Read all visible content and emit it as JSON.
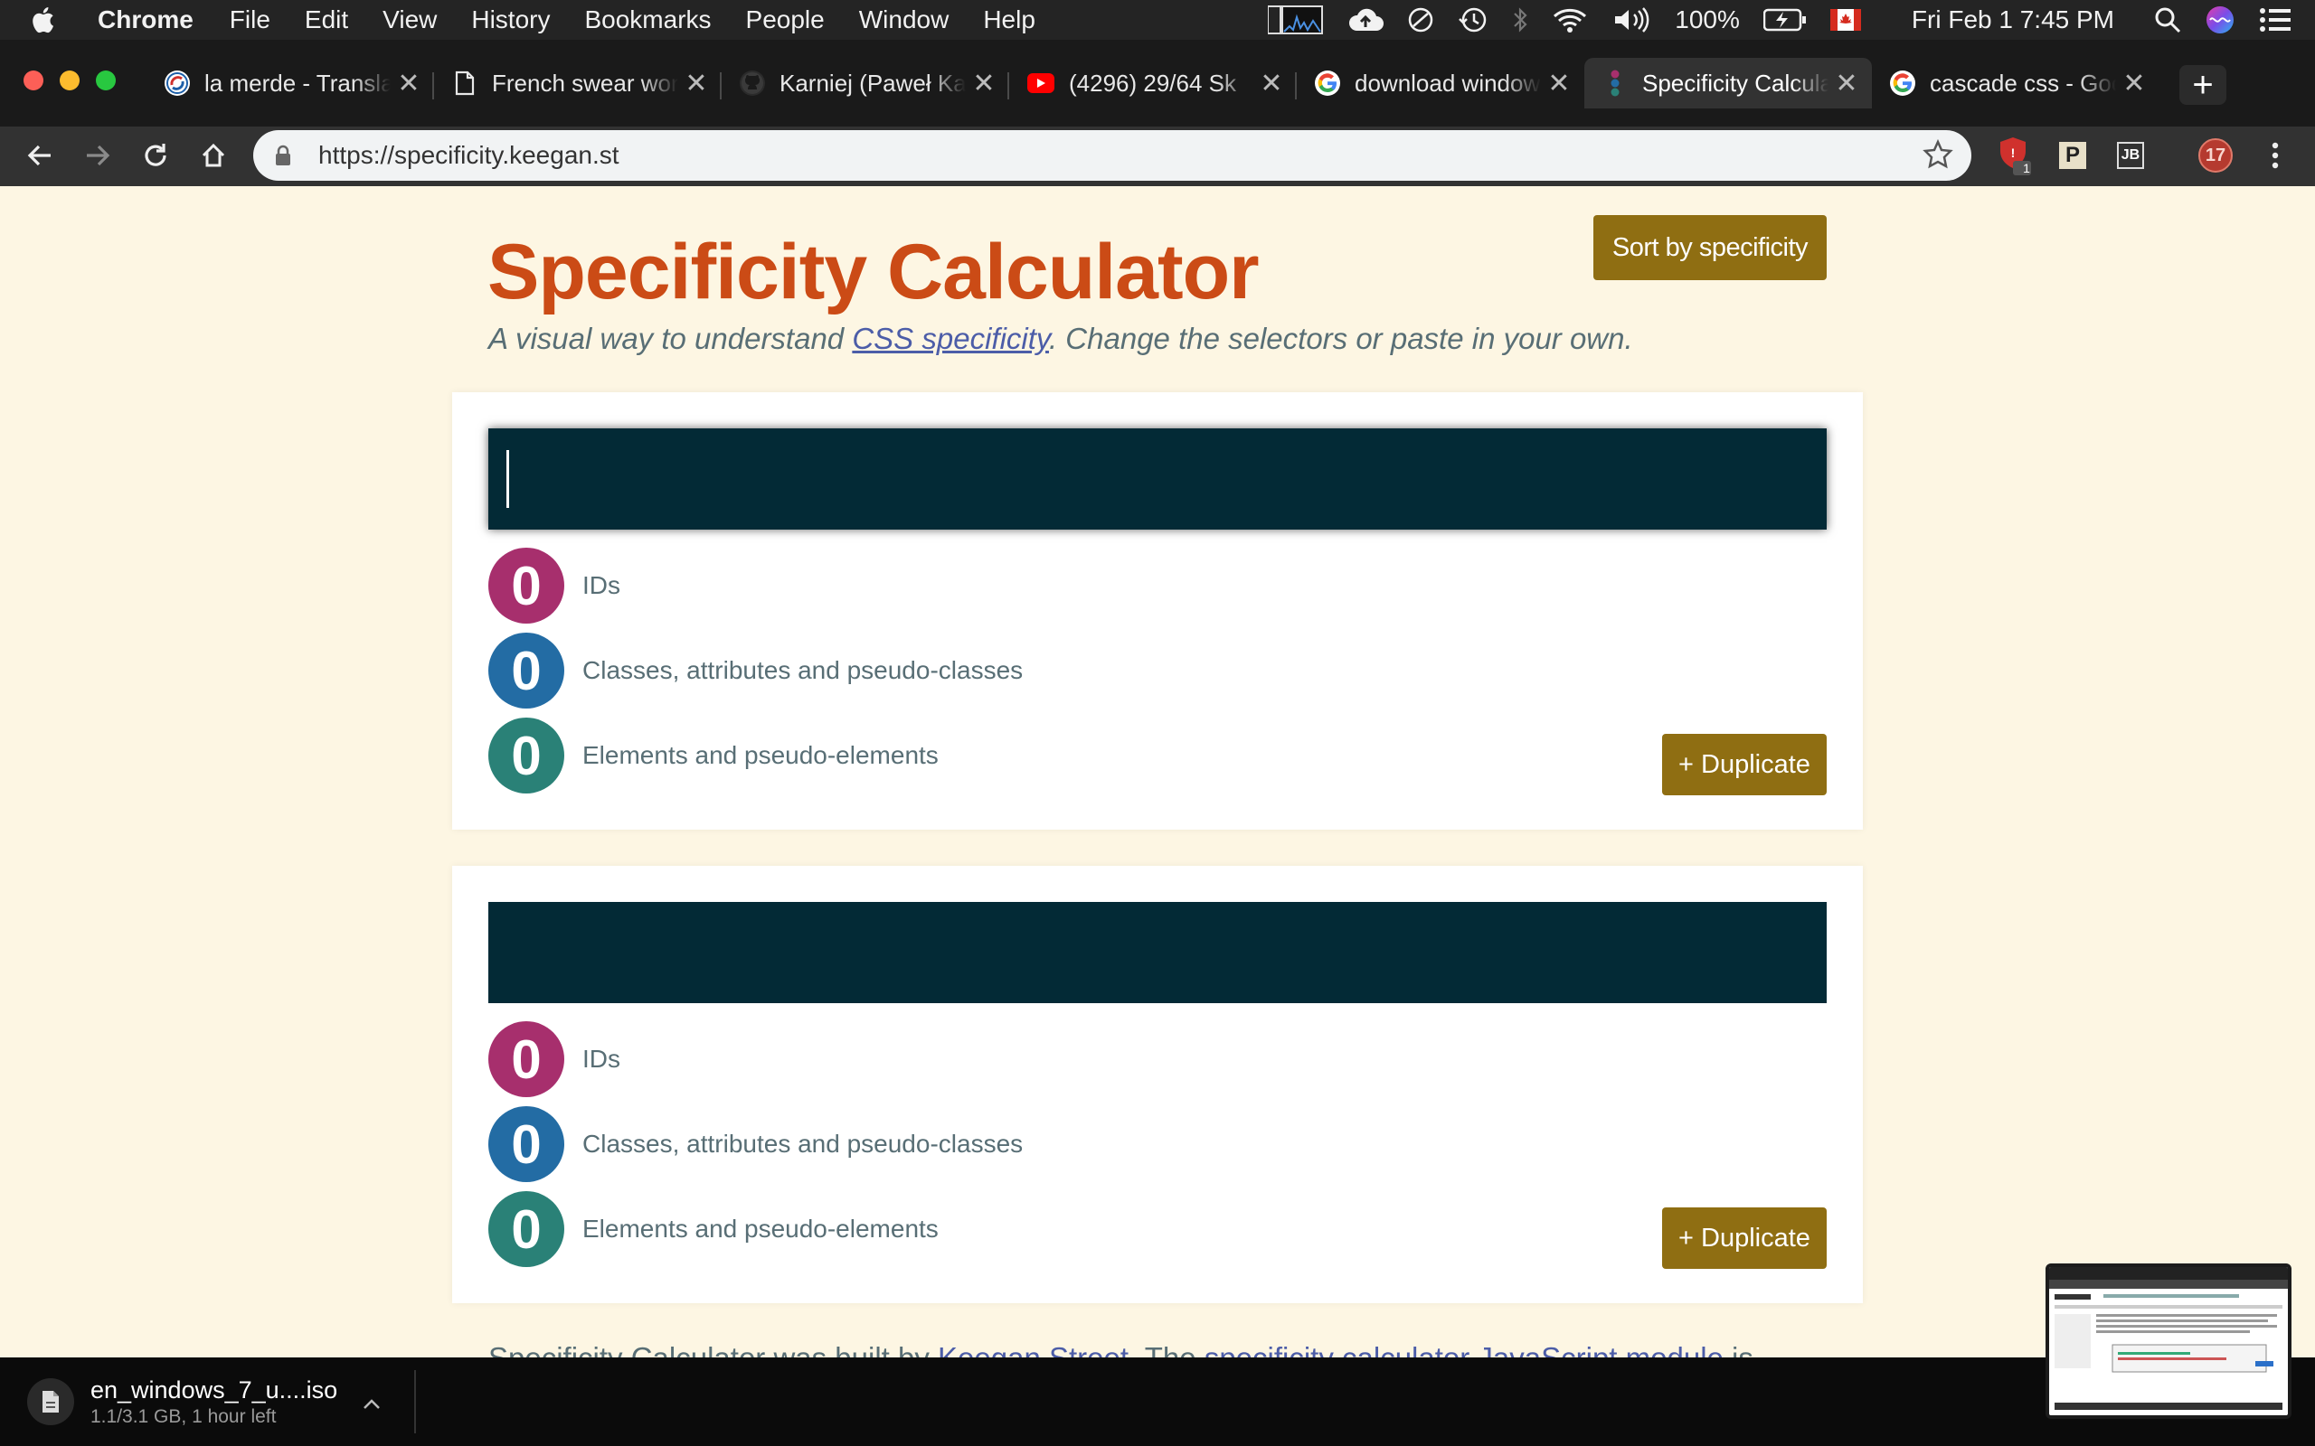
{
  "menubar": {
    "app_name": "Chrome",
    "items": [
      "File",
      "Edit",
      "View",
      "History",
      "Bookmarks",
      "People",
      "Window",
      "Help"
    ],
    "battery": "100%",
    "clock": "Fri Feb 1  7:45 PM"
  },
  "tabs": [
    {
      "title": "la merde - Translate",
      "icon": "reverso-icon",
      "active": false
    },
    {
      "title": "French swear words",
      "icon": "document-icon",
      "active": false
    },
    {
      "title": "Karniej (Paweł Karniej)",
      "icon": "github-icon",
      "active": false
    },
    {
      "title": "(4296) 29/64 Sk",
      "icon": "youtube-icon",
      "active": false
    },
    {
      "title": "download windows",
      "icon": "google-icon",
      "active": false
    },
    {
      "title": "Specificity Calculator",
      "icon": "specificity-icon",
      "active": true
    },
    {
      "title": "cascade css - Google",
      "icon": "google-icon",
      "active": false
    }
  ],
  "address_bar": {
    "url": "https://specificity.keegan.st"
  },
  "extensions": {
    "badge_count": "1",
    "pinterest_label": "P",
    "jb_label": "JB",
    "profile_count": "17"
  },
  "page": {
    "title": "Specificity Calculator",
    "subtitle_before": "A visual way to understand ",
    "subtitle_link": "CSS specificity",
    "subtitle_after": ". Change the selectors or paste in your own.",
    "sort_button": "Sort by specificity",
    "cards": [
      {
        "selector_value": "",
        "ids": {
          "count": "0",
          "label": "IDs"
        },
        "classes": {
          "count": "0",
          "label": "Classes, attributes and pseudo-classes"
        },
        "elements": {
          "count": "0",
          "label": "Elements and pseudo-elements"
        },
        "duplicate_button": "+ Duplicate"
      },
      {
        "selector_value": "",
        "ids": {
          "count": "0",
          "label": "IDs"
        },
        "classes": {
          "count": "0",
          "label": "Classes, attributes and pseudo-classes"
        },
        "elements": {
          "count": "0",
          "label": "Elements and pseudo-elements"
        },
        "duplicate_button": "+ Duplicate"
      }
    ],
    "footer_before": "Specificity Calculator was built by ",
    "footer_link1": "Keegan Street",
    "footer_middle": ". The ",
    "footer_link2": "specificity calculator JavaScript module",
    "footer_after": " is"
  },
  "colors": {
    "ids": "#a72f6d",
    "classes": "#236ca4",
    "elements": "#2a8177",
    "button": "#8f6e12",
    "title": "#cb4b16",
    "selector_bg": "#032a36"
  },
  "download": {
    "filename": "en_windows_7_u....iso",
    "status": "1.1/3.1 GB, 1 hour left"
  }
}
